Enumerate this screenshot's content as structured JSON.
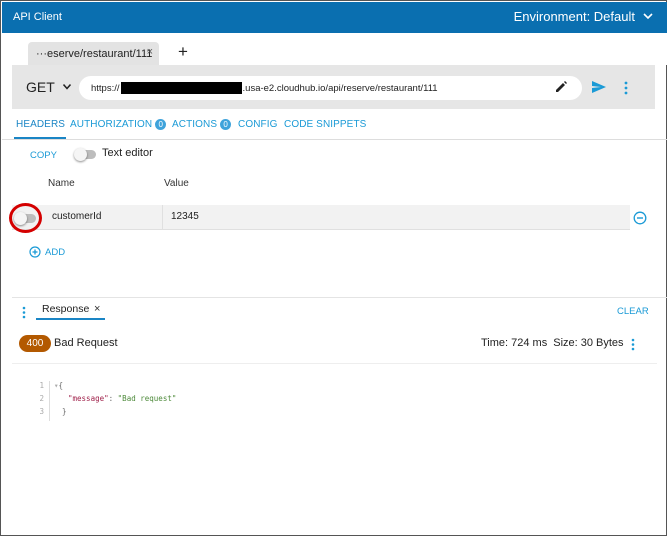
{
  "app": {
    "title": "API Client",
    "environment_label": "Environment: Default"
  },
  "request_tab": {
    "label": "···eserve/restaurant/111",
    "close": "×",
    "add": "+"
  },
  "request": {
    "method": "GET",
    "url_prefix": "https://",
    "url_suffix": ".usa-e2.cloudhub.io/api/reserve/restaurant/111"
  },
  "section_tabs": [
    {
      "label": "HEADERS"
    },
    {
      "label": "AUTHORIZATION",
      "badge": "0"
    },
    {
      "label": "ACTIONS",
      "badge": "0"
    },
    {
      "label": "CONFIG"
    },
    {
      "label": "CODE SNIPPETS"
    }
  ],
  "headers_panel": {
    "copy_label": "COPY",
    "text_editor_label": "Text editor",
    "columns": {
      "name": "Name",
      "value": "Value"
    },
    "rows": [
      {
        "name": "customerId",
        "value": "12345"
      }
    ],
    "add_label": "ADD"
  },
  "response": {
    "tab_label": "Response",
    "tab_close": "×",
    "clear_label": "CLEAR",
    "status_code": "400",
    "status_text": "Bad Request",
    "time": "Time: 724 ms",
    "size": "Size: 30 Bytes",
    "code_lines": [
      {
        "n": "1",
        "text": "{"
      },
      {
        "n": "2",
        "key": "\"message\"",
        "sep": ": ",
        "val": "\"Bad request\""
      },
      {
        "n": "3",
        "text": "}"
      }
    ]
  },
  "colors": {
    "titlebar": "#0a6fb0",
    "accent": "#1a9ad6",
    "status_badge": "#b35900",
    "highlight_circle": "#d40000"
  }
}
